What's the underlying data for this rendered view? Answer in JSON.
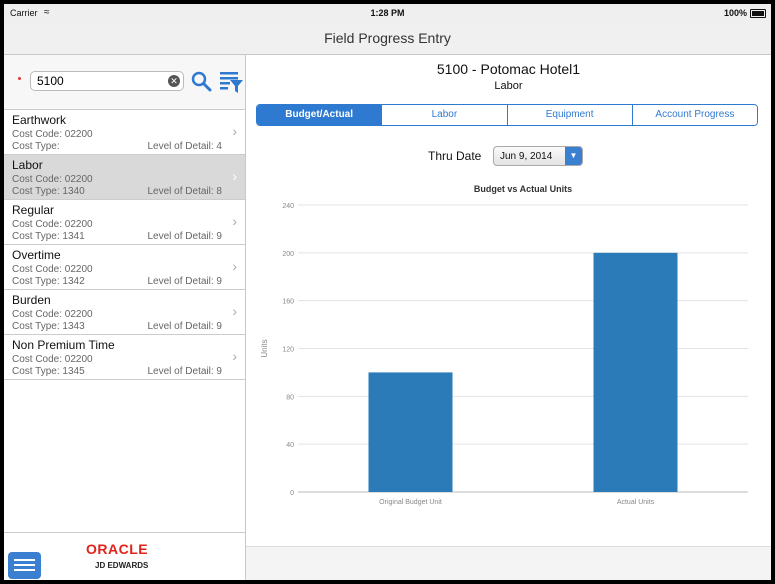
{
  "status": {
    "carrier": "Carrier",
    "time": "1:28 PM",
    "battery": "100%"
  },
  "app": {
    "title": "Field Progress Entry"
  },
  "search": {
    "value": "5100",
    "placeholder": ""
  },
  "list": {
    "items": [
      {
        "name": "Earthwork",
        "cost_code": "Cost Code: 02200",
        "cost_type": "Cost Type:",
        "level": "Level of Detail: 4",
        "selected": false
      },
      {
        "name": "Labor",
        "cost_code": "Cost Code: 02200",
        "cost_type": "Cost Type: 1340",
        "level": "Level of Detail: 8",
        "selected": true
      },
      {
        "name": "Regular",
        "cost_code": "Cost Code: 02200",
        "cost_type": "Cost Type: 1341",
        "level": "Level of Detail: 9",
        "selected": false
      },
      {
        "name": "Overtime",
        "cost_code": "Cost Code: 02200",
        "cost_type": "Cost Type: 1342",
        "level": "Level of Detail: 9",
        "selected": false
      },
      {
        "name": "Burden",
        "cost_code": "Cost Code: 02200",
        "cost_type": "Cost Type: 1343",
        "level": "Level of Detail: 9",
        "selected": false
      },
      {
        "name": "Non Premium Time",
        "cost_code": "Cost Code: 02200",
        "cost_type": "Cost Type: 1345",
        "level": "Level of Detail: 9",
        "selected": false
      }
    ]
  },
  "branding": {
    "oracle": "ORACLE",
    "jde": "JD EDWARDS"
  },
  "detail": {
    "job_title": "5100 - Potomac Hotel1",
    "subtitle": "Labor",
    "tabs": [
      {
        "label": "Budget/Actual",
        "active": true
      },
      {
        "label": "Labor",
        "active": false
      },
      {
        "label": "Equipment",
        "active": false
      },
      {
        "label": "Account Progress",
        "active": false
      }
    ],
    "thru_date_label": "Thru Date",
    "thru_date_value": "Jun 9, 2014"
  },
  "colors": {
    "accent": "#2f7ad1",
    "bar": "#2b7bb9",
    "oracle_red": "#e2231a"
  },
  "chart_data": {
    "type": "bar",
    "title": "Budget vs Actual Units",
    "xlabel": "",
    "ylabel": "Units",
    "categories": [
      "Original Budget Unit",
      "Actual Units"
    ],
    "values": [
      100,
      200
    ],
    "ylim": [
      0,
      240
    ],
    "yticks": [
      0,
      40,
      80,
      120,
      160,
      200,
      240
    ],
    "grid": true,
    "legend": "none"
  }
}
